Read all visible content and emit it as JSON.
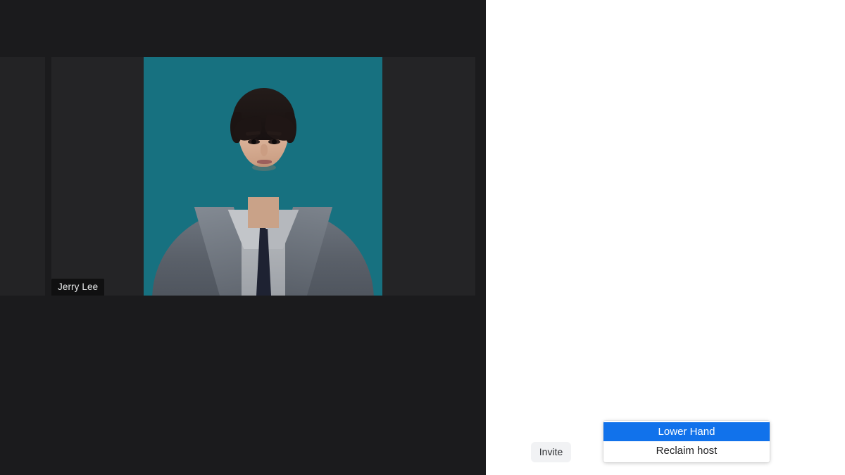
{
  "meeting": {
    "stage": {
      "active_tile": {
        "participant_name": "Jerry Lee",
        "video_state": "camera-on"
      }
    },
    "colors": {
      "stage_background": "#1b1b1d",
      "tile_background": "#242426",
      "photo_backdrop": "#177180",
      "panel_background": "#ffffff",
      "menu_highlight": "#1172eb",
      "invite_button_background": "#f1f2f4"
    }
  },
  "side_panel": {
    "invite_button_label": "Invite"
  },
  "context_menu": {
    "items": [
      {
        "label": "Lower Hand",
        "highlighted": true
      },
      {
        "label": "Reclaim host",
        "highlighted": false
      }
    ]
  }
}
